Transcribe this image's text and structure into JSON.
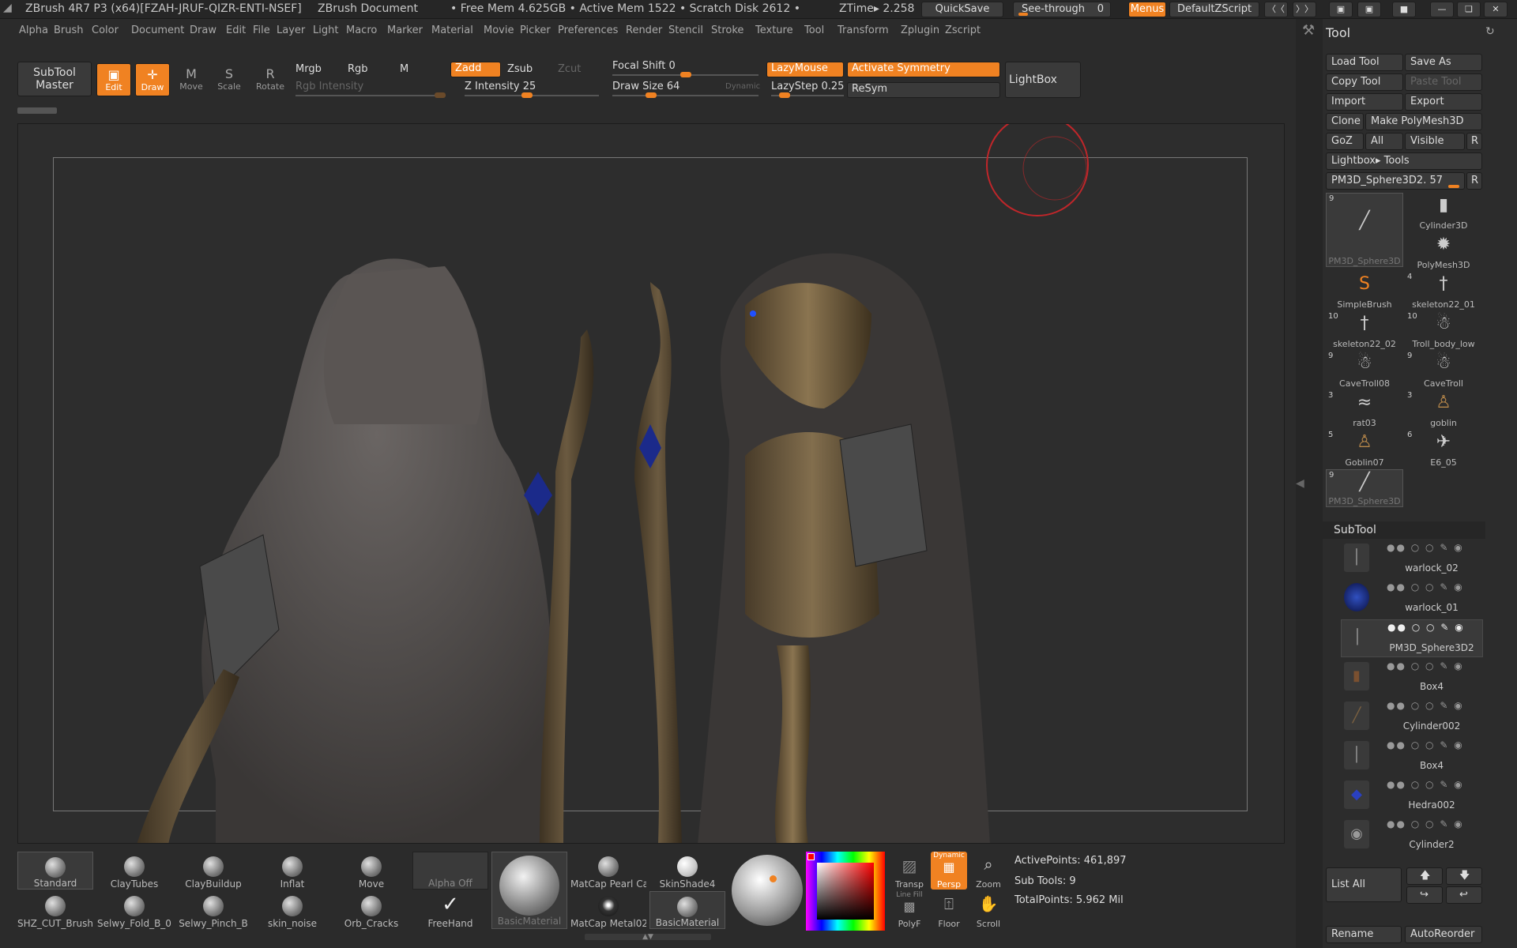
{
  "window": {
    "title": "ZBrush 4R7 P3 (x64)[FZAH-JRUF-QIZR-ENTI-NSEF]",
    "document": "ZBrush Document",
    "status": "• Free Mem 4.625GB • Active Mem 1522 • Scratch Disk 2612 •",
    "ztime": "ZTime▸ 2.258",
    "quicksave": "QuickSave",
    "see_through": "See-through",
    "see_through_value": "0",
    "menus": "Menus",
    "script": "DefaultZScript"
  },
  "menu": [
    "Alpha",
    "Brush",
    "Color",
    "Document",
    "Draw",
    "Edit",
    "File",
    "Layer",
    "Light",
    "Macro",
    "Marker",
    "Material",
    "Movie",
    "Picker",
    "Preferences",
    "Render",
    "Stencil",
    "Stroke",
    "Texture",
    "Tool",
    "Transform",
    "Zplugin",
    "Zscript"
  ],
  "shelf": {
    "subtool_master": [
      "SubTool",
      "Master"
    ],
    "modes": [
      {
        "label": "Edit",
        "glyph": "▣",
        "on": true
      },
      {
        "label": "Draw",
        "glyph": "✛",
        "on": true
      },
      {
        "label": "Move",
        "glyph": "M",
        "on": false
      },
      {
        "label": "Scale",
        "glyph": "S",
        "on": false
      },
      {
        "label": "Rotate",
        "glyph": "R",
        "on": false
      }
    ],
    "mrgb": "Mrgb",
    "rgb": "Rgb",
    "m": "M",
    "zadd": "Zadd",
    "zsub": "Zsub",
    "zcut": "Zcut",
    "rgb_intensity": "Rgb Intensity",
    "z_intensity": "Z Intensity 25",
    "focal_shift": "Focal Shift 0",
    "draw_size": "Draw Size 64",
    "dynamic": "Dynamic",
    "lazymouse": "LazyMouse",
    "lazystep": "LazyStep 0.25",
    "activate_symmetry": "Activate Symmetry",
    "resym": "ReSym",
    "lightbox": "LightBox"
  },
  "tool_panel": {
    "title": "Tool",
    "buttons": {
      "load": "Load Tool",
      "save": "Save As",
      "copy": "Copy Tool",
      "paste": "Paste Tool",
      "import": "Import",
      "export": "Export",
      "clone": "Clone",
      "make_poly": "Make PolyMesh3D",
      "goz": "GoZ",
      "all": "All",
      "visible": "Visible",
      "r": "R"
    },
    "lightbox_tools": "Lightbox▸ Tools",
    "current_tool": "PM3D_Sphere3D2. 57",
    "tools": [
      {
        "num": "9",
        "name": "PM3D_Sphere3D",
        "icon": "╱"
      },
      {
        "num": "",
        "name": "Cylinder3D",
        "icon": "▮"
      },
      {
        "num": "",
        "name": "PolyMesh3D",
        "icon": "✹"
      },
      {
        "num": "",
        "name": "SimpleBrush",
        "icon": "S"
      },
      {
        "num": "4",
        "name": "skeleton22_01",
        "icon": "†"
      },
      {
        "num": "10",
        "name": "skeleton22_02",
        "icon": "†"
      },
      {
        "num": "10",
        "name": "Troll_body_low",
        "icon": "☃"
      },
      {
        "num": "9",
        "name": "CaveTroll08",
        "icon": "☃"
      },
      {
        "num": "9",
        "name": "CaveTroll",
        "icon": "☃"
      },
      {
        "num": "3",
        "name": "rat03",
        "icon": "≈"
      },
      {
        "num": "3",
        "name": "goblin",
        "icon": "♙"
      },
      {
        "num": "5",
        "name": "Goblin07",
        "icon": "♙"
      },
      {
        "num": "6",
        "name": "E6_05",
        "icon": "✈"
      },
      {
        "num": "9",
        "name": "PM3D_Sphere3D",
        "icon": "╱"
      }
    ],
    "subtool_title": "SubTool",
    "subtools": [
      "warlock_02",
      "warlock_01",
      "PM3D_Sphere3D2",
      "Box4",
      "Cylinder002",
      "Box4",
      "Hedra002",
      "Cylinder2"
    ],
    "list_all": "List All",
    "rename": "Rename",
    "auto_reorder": "AutoReorder"
  },
  "bottom": {
    "brushes": [
      "Standard",
      "ClayTubes",
      "ClayBuildup",
      "Inflat",
      "Move",
      "SHZ_CUT_Brush",
      "Selwy_Fold_B_0",
      "Selwy_Pinch_B",
      "skin_noise",
      "Orb_Cracks"
    ],
    "alpha": "Alpha Off",
    "stroke": "FreeHand",
    "material_main": "BasicMaterial",
    "materials": [
      "MatCap Pearl Ca",
      "SkinShade4",
      "MatCap Metal02",
      "BasicMaterial"
    ],
    "nav": [
      {
        "label": "Transp",
        "glyph": "▨"
      },
      {
        "label": "Persp",
        "glyph": "▦",
        "on": true,
        "top": "Dynamic"
      },
      {
        "label": "Zoom",
        "glyph": "⌕"
      },
      {
        "label": "PolyF",
        "glyph": "▩",
        "top": "Line Fill"
      },
      {
        "label": "Floor",
        "glyph": "⍐"
      },
      {
        "label": "Scroll",
        "glyph": "✋"
      }
    ],
    "active_points": "ActivePoints: 461,897",
    "sub_tools": "Sub Tools: 9",
    "total_points": "TotalPoints: 5.962 Mil"
  },
  "colors": {
    "accent": "#f08222",
    "panel": "#2c2c2c",
    "viewport": "#2d2d2d"
  }
}
